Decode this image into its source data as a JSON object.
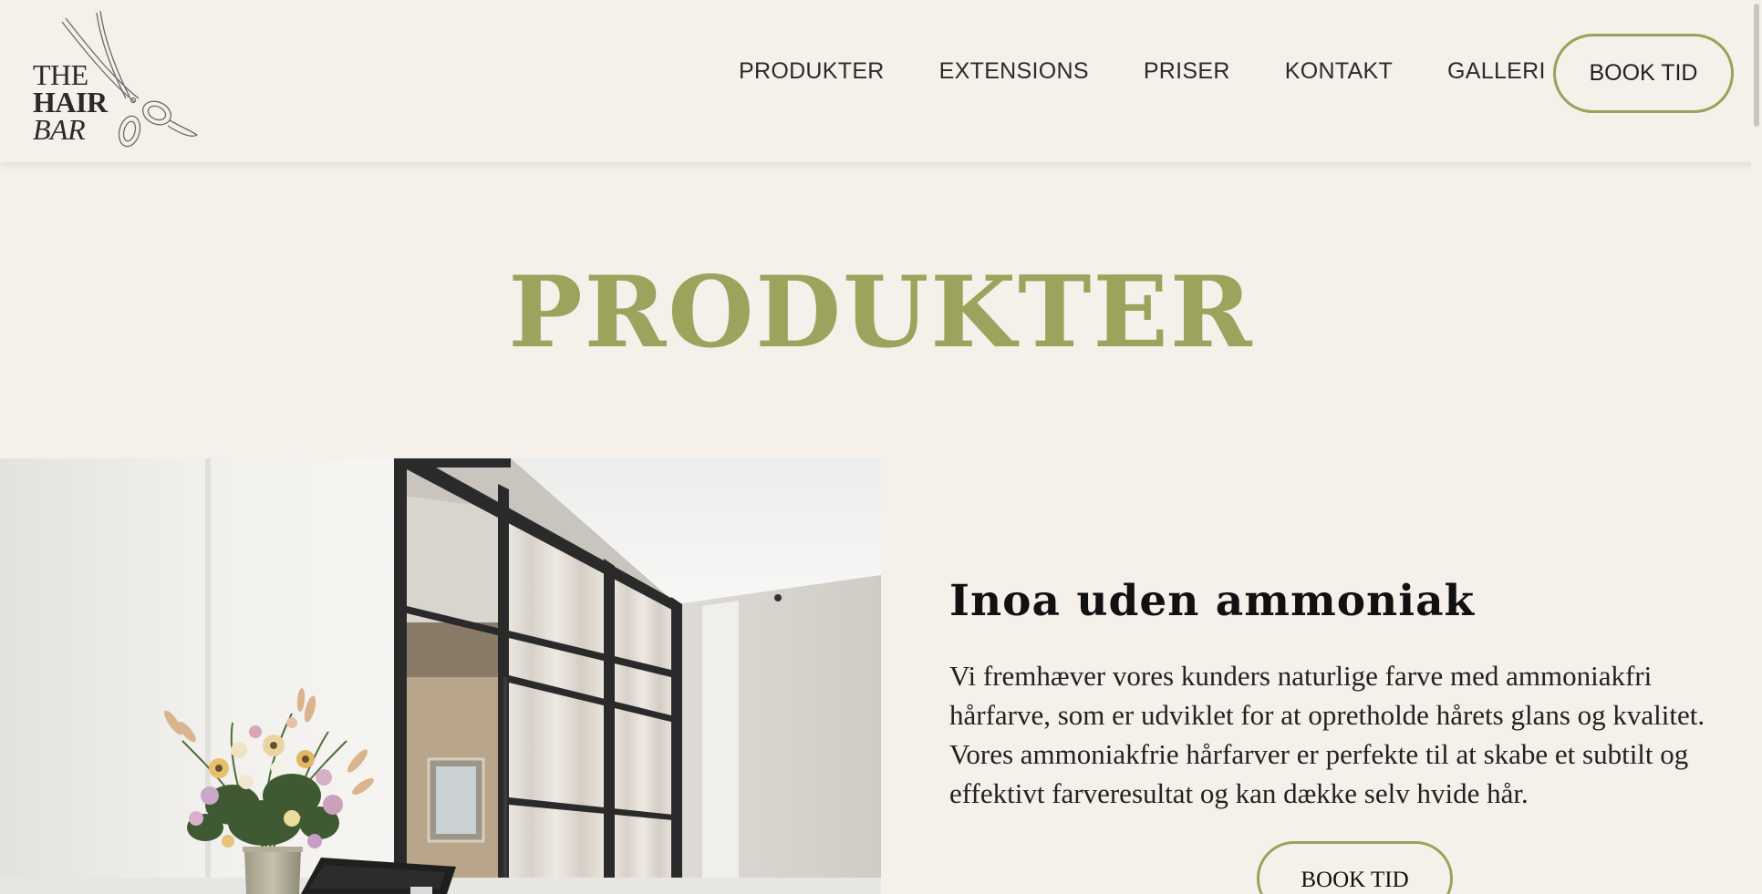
{
  "logo": {
    "line1": "THE",
    "line2": "HAIR",
    "line3": "BAR",
    "icon": "scissors-icon"
  },
  "nav": {
    "items": [
      {
        "label": "PRODUKTER"
      },
      {
        "label": "EXTENSIONS"
      },
      {
        "label": "PRISER"
      },
      {
        "label": "KONTAKT"
      },
      {
        "label": "GALLERI"
      }
    ],
    "book_label": "BOOK TID"
  },
  "page": {
    "title": "PRODUKTER"
  },
  "product": {
    "title": "Inoa uden ammoniak",
    "description": "Vi fremhæver vores kunders naturlige farve med ammoniakfri hårfarve, som er udviklet for at opretholde hårets glans og kvalitet. Vores ammoniakfrie hårfarver er perfekte til at skabe et subtilt og effektivt farveresultat og kan dække selv hvide hår.",
    "book_label": "BOOK TID"
  },
  "colors": {
    "background": "#f5f0e9",
    "accent": "#9ba35d",
    "text": "#222222"
  }
}
